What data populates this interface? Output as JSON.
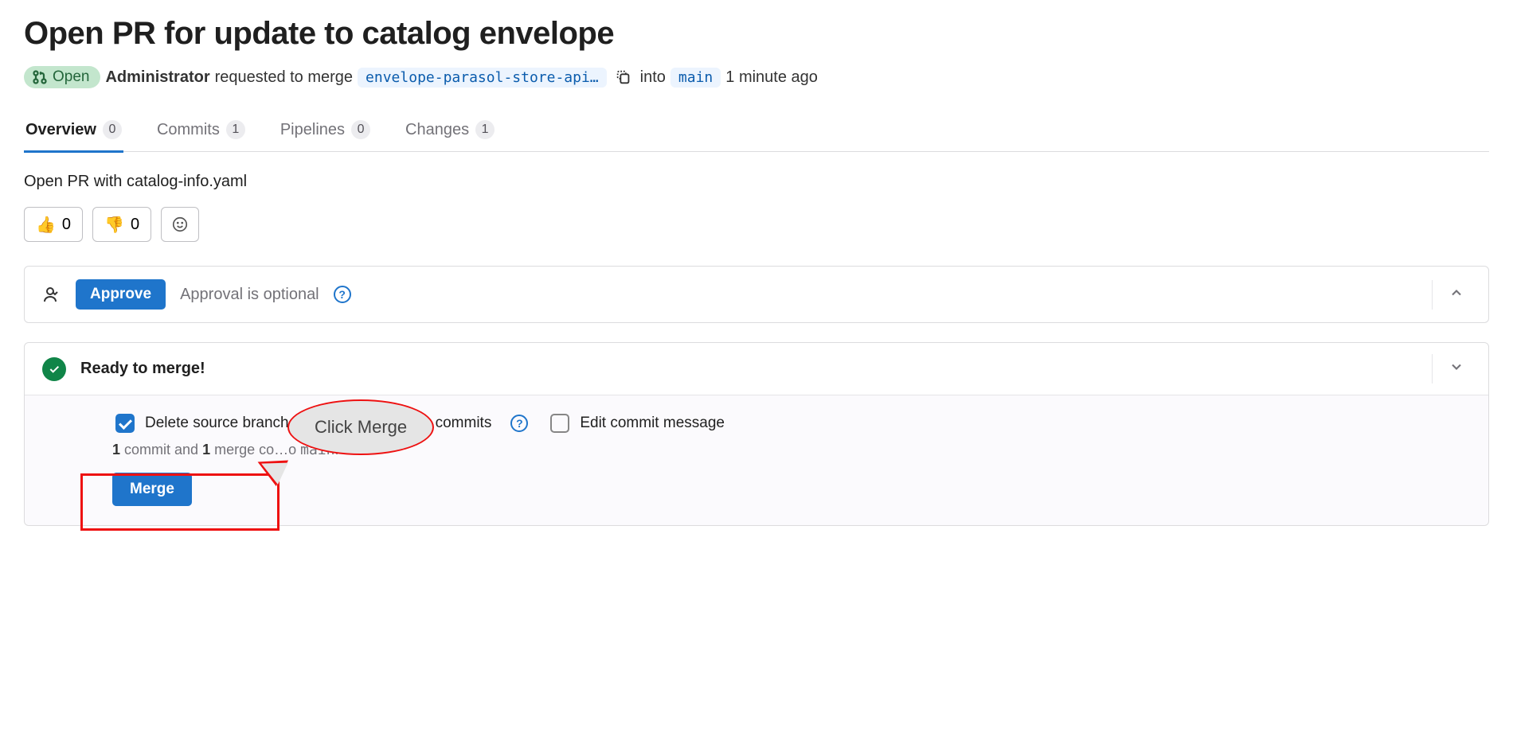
{
  "title": "Open PR for update to catalog envelope",
  "status": {
    "label": "Open"
  },
  "meta": {
    "author": "Administrator",
    "action_text": "requested to merge",
    "source_branch": "envelope-parasol-store-api…",
    "into_text": "into",
    "target_branch": "main",
    "time": "1 minute ago"
  },
  "tabs": [
    {
      "label": "Overview",
      "count": "0",
      "active": true
    },
    {
      "label": "Commits",
      "count": "1",
      "active": false
    },
    {
      "label": "Pipelines",
      "count": "0",
      "active": false
    },
    {
      "label": "Changes",
      "count": "1",
      "active": false
    }
  ],
  "description": "Open PR with catalog-info.yaml",
  "reactions": {
    "thumbs_up": {
      "emoji": "👍",
      "count": "0"
    },
    "thumbs_down": {
      "emoji": "👎",
      "count": "0"
    },
    "add_emoji": "☺"
  },
  "approval": {
    "button": "Approve",
    "note": "Approval is optional"
  },
  "merge": {
    "ready_text": "Ready to merge!",
    "opt_delete": "Delete source branch",
    "opt_squash_suffix": "commits",
    "opt_edit": "Edit commit message",
    "summary_prefix": "1",
    "summary_mid1": " commit and ",
    "summary_mid2": "1",
    "summary_mid3": " merge commit will be added to ",
    "summary_branch": "main",
    "summary_end": ".",
    "button": "Merge"
  },
  "callout": {
    "text": "Click Merge"
  }
}
